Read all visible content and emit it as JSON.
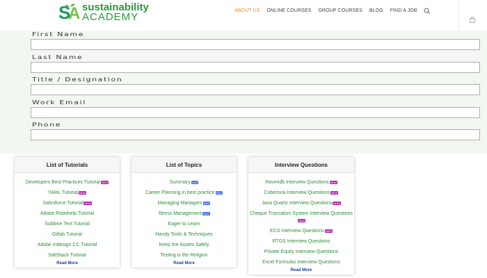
{
  "header": {
    "logo_line1": "sustainability",
    "logo_line2": "ACADEMY",
    "nav": [
      "ABOUT US",
      "ONLINE COURSES",
      "GROUP COURSES",
      "BLOG",
      "FIND A JOB"
    ]
  },
  "form": {
    "fields": [
      {
        "label": "First Name",
        "value": ""
      },
      {
        "label": "Last Name",
        "value": ""
      },
      {
        "label": "Title / Designation",
        "value": ""
      },
      {
        "label": "Work Email",
        "value": ""
      },
      {
        "label": "Phone",
        "value": ""
      }
    ]
  },
  "cards": [
    {
      "title": "List of Tutorials",
      "items": [
        {
          "text": "Developers Best Practices Tutorial",
          "badge": "NEW"
        },
        {
          "text": "YAML Tutorial",
          "badge": "NEW"
        },
        {
          "text": "Salesforce Tutorial",
          "badge": "NEW"
        },
        {
          "text": "Adobe Robohelp Tutorial",
          "badge": ""
        },
        {
          "text": "Sublime Text Tutorial",
          "badge": ""
        },
        {
          "text": "Gitlab Tutorial",
          "badge": ""
        },
        {
          "text": "Adobe Indesign CC Tutorial",
          "badge": ""
        },
        {
          "text": "SaltStack Tutorial",
          "badge": ""
        }
      ],
      "read_more": "Read More"
    },
    {
      "title": "List of Topics",
      "items": [
        {
          "text": "Summary",
          "badge": "HOT"
        },
        {
          "text": "Career Planning in best practice",
          "badge": "HOT"
        },
        {
          "text": "Managing Managers",
          "badge": "HOT"
        },
        {
          "text": "Stress Management",
          "badge": "HOT"
        },
        {
          "text": "Eager to Learn",
          "badge": ""
        },
        {
          "text": "Handy Tools & Techniques",
          "badge": ""
        },
        {
          "text": "Keep the Assets Safely",
          "badge": ""
        },
        {
          "text": "Testing is the Religion",
          "badge": ""
        }
      ],
      "read_more": "Read More"
    },
    {
      "title": "Interview Questions",
      "items": [
        {
          "text": "Ravendb Interview Questions",
          "badge": "NEW"
        },
        {
          "text": "Cobertura Interview Questions",
          "badge": "NEW"
        },
        {
          "text": "Java Quartz Interview Questions",
          "badge": "NEW"
        },
        {
          "text": "Cheque Truncation System Interview Questions",
          "badge": "NEW"
        },
        {
          "text": "ECS Interview Questions",
          "badge": "NEW"
        },
        {
          "text": "RTGS Interview Questions",
          "badge": ""
        },
        {
          "text": "Private Equity Interview Questions",
          "badge": ""
        },
        {
          "text": "Excel Formulas Interview Questions",
          "badge": ""
        }
      ],
      "read_more": "Read More"
    }
  ],
  "colors": {
    "accent": "#f08a24",
    "link_green": "#2e8b3a",
    "read_more": "#1f3fa3",
    "badge_new": "#b31fa8",
    "badge_hot": "#4a6fe3"
  }
}
